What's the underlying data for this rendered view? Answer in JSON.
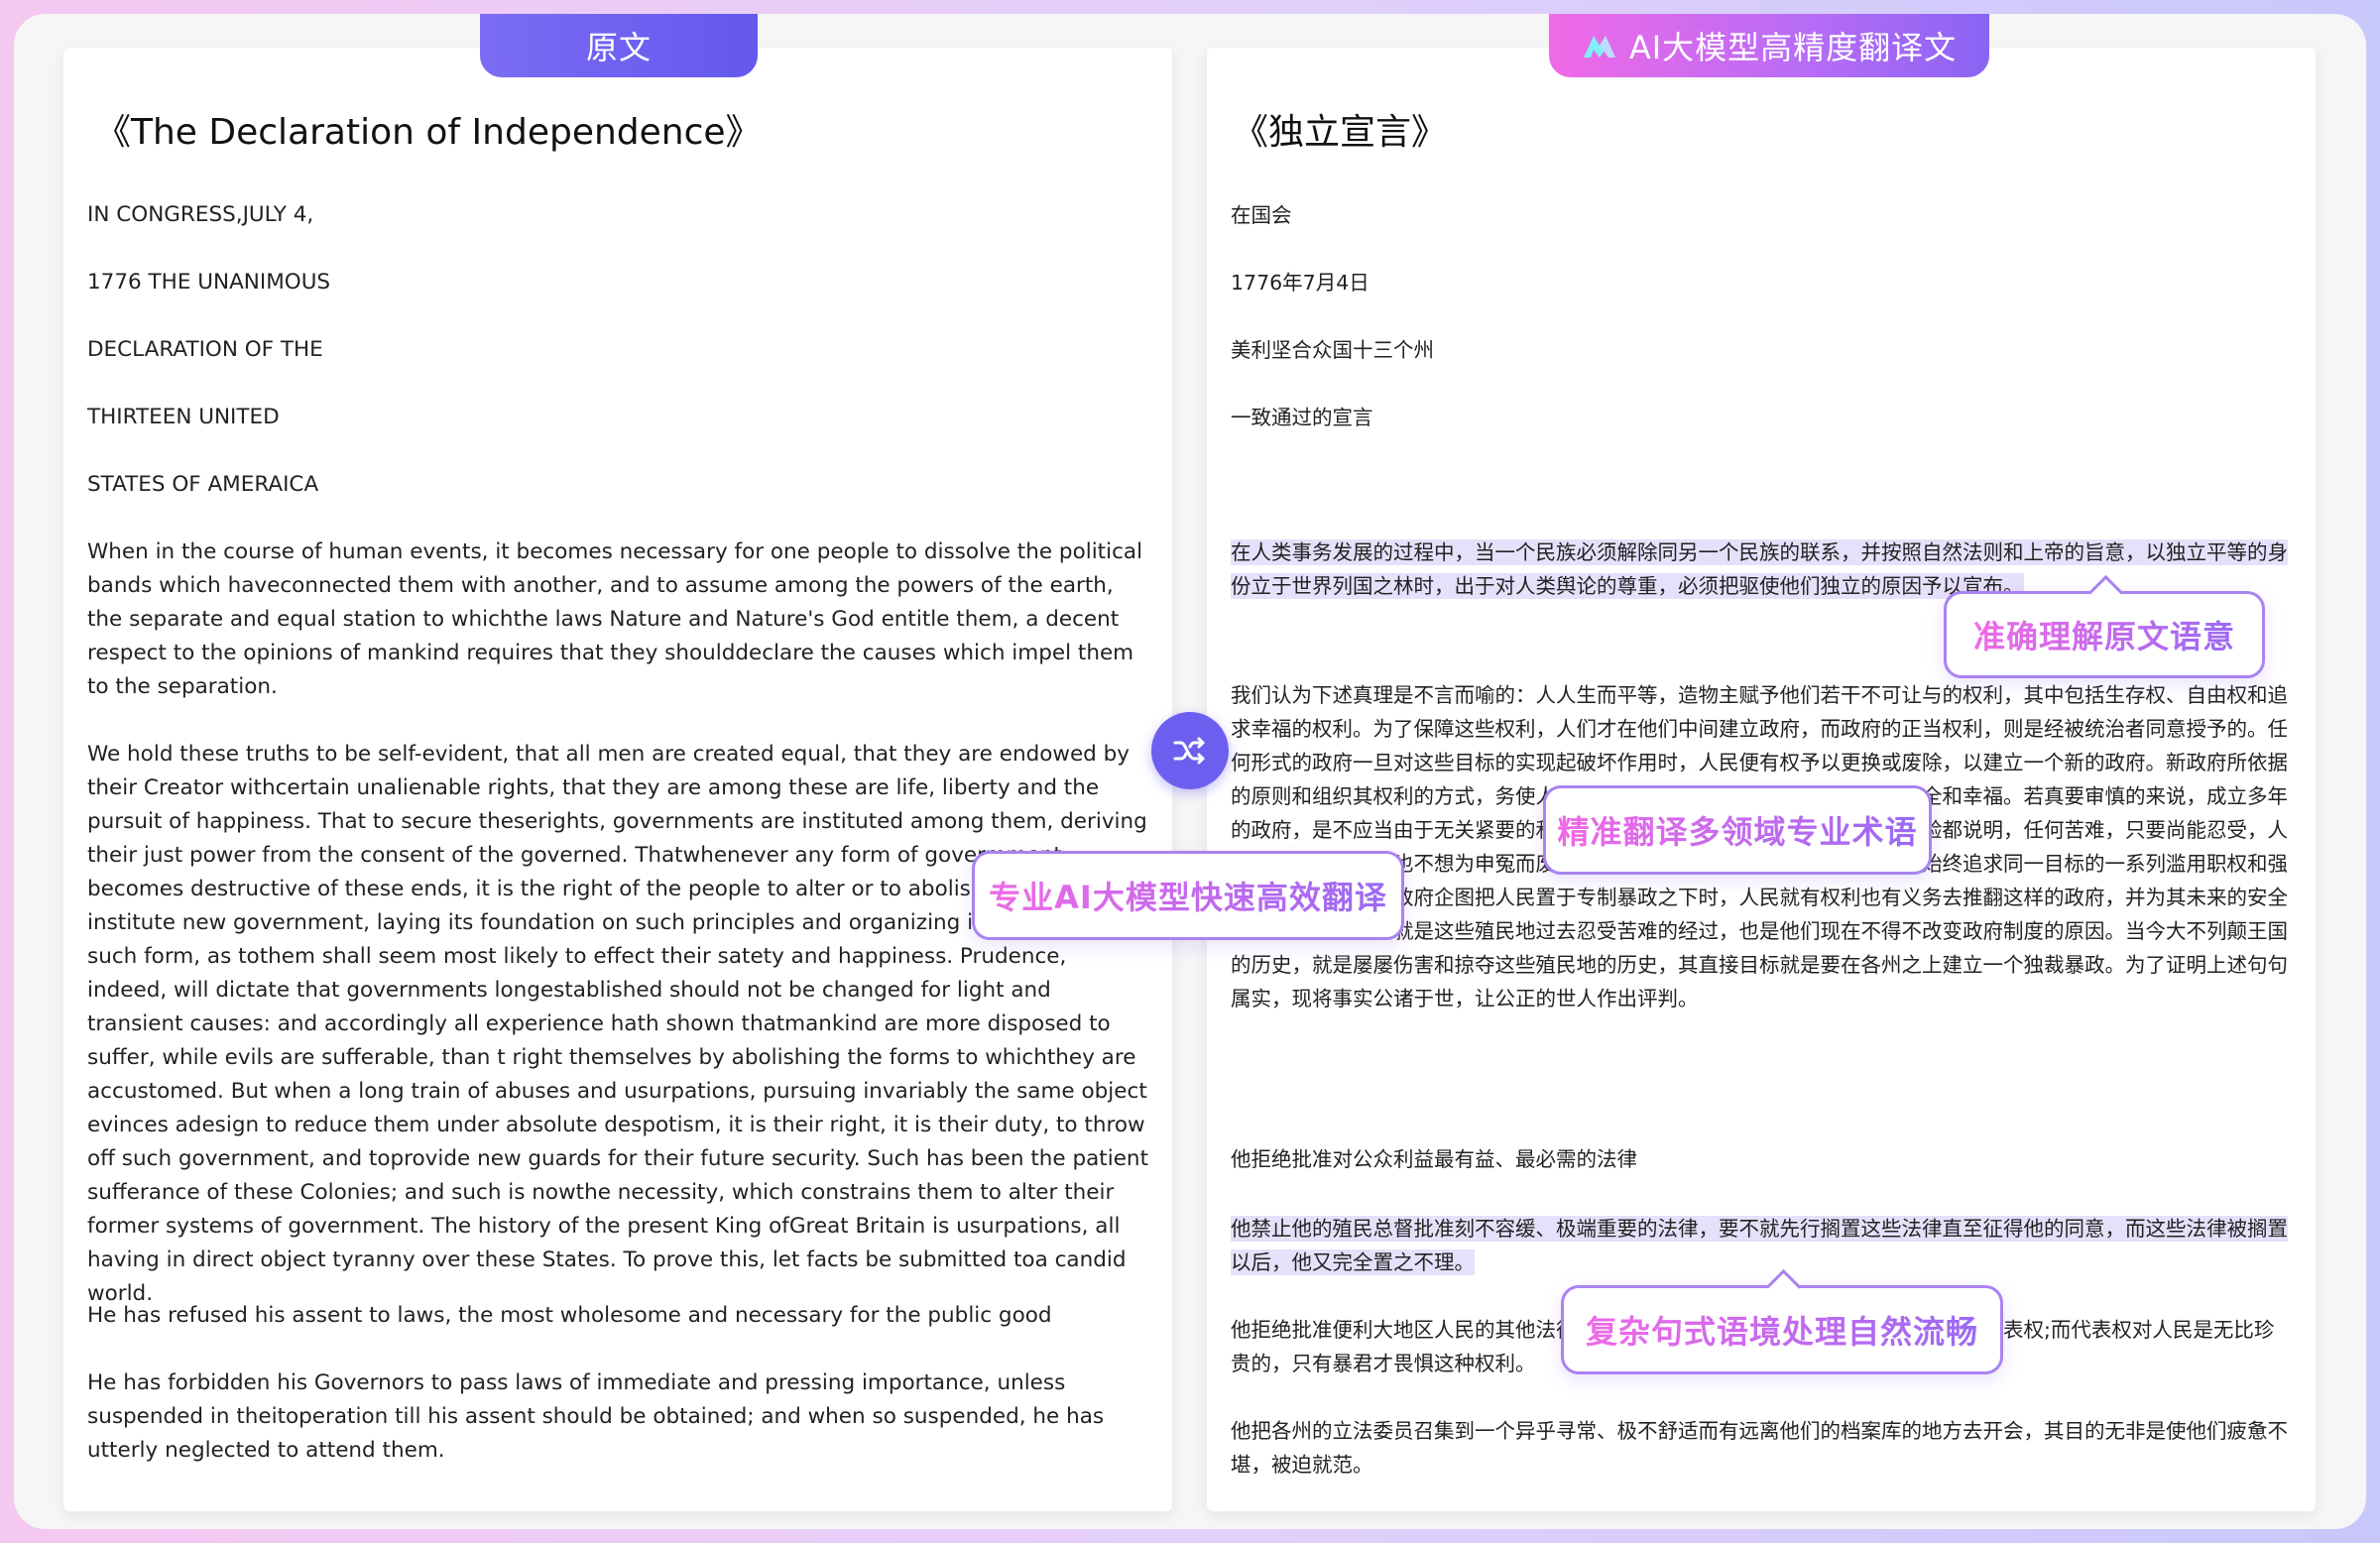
{
  "tabs": {
    "original": "原文",
    "translated": "AI大模型高精度翻译文"
  },
  "original_doc": {
    "title": "《The Declaration of Independence》",
    "lines": [
      "IN CONGRESS,JULY 4,",
      "1776 THE UNANIMOUS",
      "DECLARATION OF THE",
      "THIRTEEN UNITED",
      "STATES OF AMERAICA"
    ],
    "paragraphs": [
      "When in the course of human events, it becomes necessary for one people to dissolve the political bands which haveconnected them with another, and to assume among the powers of the earth, the separate and equal station to whichthe laws Nature and Nature's God entitle them, a decent respect to the opinions of mankind requires that they shoulddeclare the causes which impel them to the separation.",
      "We hold these truths to be self-evident, that all men are created equal, that they are endowed by their Creator withcertain unalienable rights, that they are among these are life, liberty and the pursuit of happiness. That to secure theserights, governments are instituted among them, deriving their just power from the consent of the governed. Thatwhenever any form of govermment becomes destructive of these ends, it is the right of the people to alter or to abolishit, and to institute new government, laying its foundation on such principles and organizing its powers in such form, as tothem shall seem most likely to effect their satety and happiness. Prudence, indeed, will dictate that governments longestablished should not be changed for light and transient causes: and accordingly all experience hath shown thatmankind are more disposed to suffer, while evils are sufferable, than t right themselves by abolishing the forms to whichthey are accustomed. But when a long train of abuses and usurpations, pursuing invariably the same object evinces adesign to reduce them under absolute despotism, it is their right, it is their duty, to throw off such government, and toprovide new guards for their future security. Such has been the patient sufferance of these Colonies; and such is nowthe necessity, which constrains them to alter their former systems of government. The history of the present King ofGreat Britain is usurpations, all having in direct object tyranny over these States. To prove this, let facts be submitted toa candid world.",
      "He has refused his assent to laws, the most wholesome and necessary for the public good",
      "He has forbidden his Governors to pass laws of immediate and pressing importance, unless suspended in theitoperation till his assent should be obtained; and when so suspended, he has utterly neglected to attend them."
    ]
  },
  "translated_doc": {
    "title": "《独立宣言》",
    "lines": [
      "在国会",
      "1776年7月4日",
      "美利坚合众国十三个州",
      "一致通过的宣言"
    ],
    "paragraphs": [
      "在人类事务发展的过程中，当一个民族必须解除同另一个民族的联系，并按照自然法则和上帝的旨意，以独立平等的身份立于世界列国之林时，出于对人类舆论的尊重，必须把驱使他们独立的原因予以宣布。",
      "我们认为下述真理是不言而喻的：人人生而平等，造物主赋予他们若干不可让与的权利，其中包括生存权、自由权和追求幸福的权利。为了保障这些权利，人们才在他们中间建立政府，而政府的正当权利，则是经被统治者同意授予的。任何形式的政府一旦对这些目标的实现起破坏作用时，人民便有权予以更换或废除，以建立一个新的政府。新政府所依据的原则和组织其权利的方式，务使人民认为唯有这样才最有可能使他们获得安全和幸福。若真要审慎的来说，成立多年的政府，是不应当由于无关紧要的和一时的原因而予以更换的。过去的一切经验都说明，任何苦难，只要尚能忍受，人类还是情愿忍受，也不想为申冤而废除他们久已习惯了的政府形式。然而，当始终追求同一目标的一系列滥用职权和强取豪夺的行为表明政府企图把人民置于专制暴政之下时，人民就有权利也有义务去推翻这样的政府，并为其未来的安全提供新的保障。这就是这些殖民地过去忍受苦难的经过，也是他们现在不得不改变政府制度的原因。当今大不列颠王国的历史，就是屡屡伤害和掠夺这些殖民地的历史，其直接目标就是要在各州之上建立一个独裁暴政。为了证明上述句句属实，现将事实公诸于世，让公正的世人作出评判。",
      "他拒绝批准对公众利益最有益、最必需的法律",
      "他禁止他的殖民总督批准刻不容缓、极端重要的法律，要不就先行搁置这些法律直至征得他的同意，而这些法律被搁置以后，他又完全置之不理。",
      "他拒绝批准便利大地区人民的其他法律，除非那些人民情愿放弃自己在立法机构中的代表权;而代表权对人民是无比珍贵的，只有暴君才畏惧这种权利。",
      "他把各州的立法委员召集到一个异乎寻常、极不舒适而有远离他们的档案库的地方去开会，其目的无非是使他们疲惫不堪，被迫就范。"
    ]
  },
  "callouts": {
    "understand": "准确理解原文语意",
    "terms": "精准翻译多领域专业术语",
    "fast": "专业AI大模型快速高效翻译",
    "context": "复杂句式语境处理自然流畅"
  },
  "icons": {
    "switch": "shuffle-icon",
    "logo": "ai-logo-icon"
  },
  "colors": {
    "accent": "#6c5ff0",
    "highlight": "#e6e0fa",
    "callout_border": "#a983f1"
  }
}
